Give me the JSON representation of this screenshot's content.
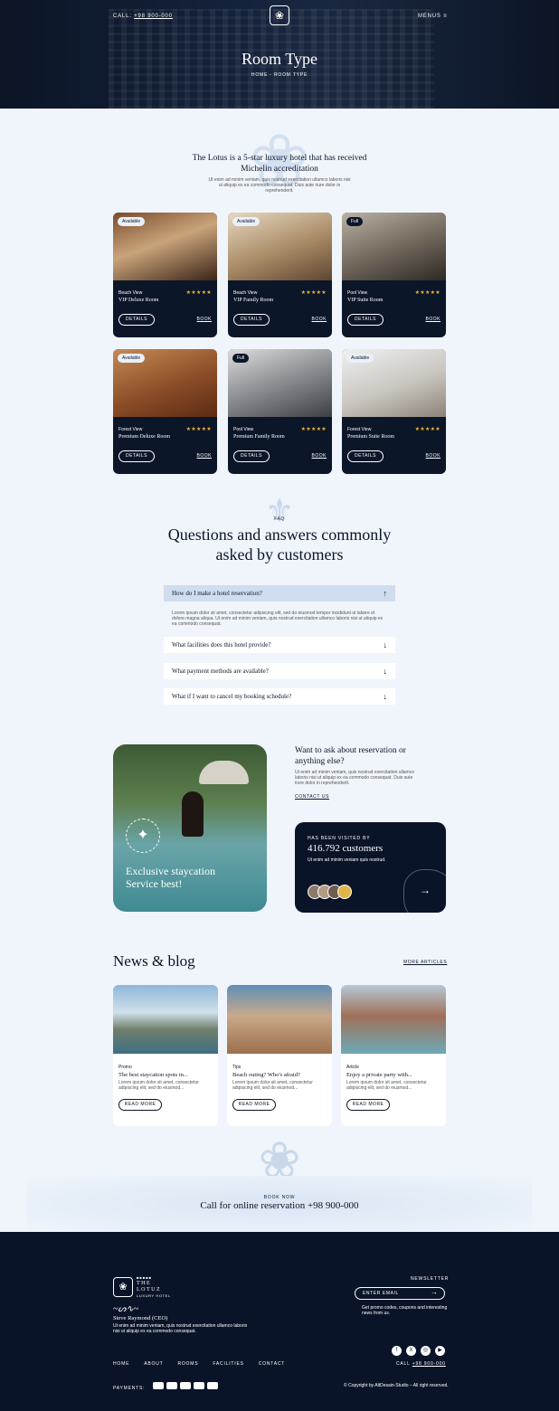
{
  "header": {
    "call": "CALL:",
    "phone": "+98 900-000",
    "menus": "MENUS",
    "title": "Room Type",
    "breadcrumb": "HOME - ROOM TYPE"
  },
  "intro": {
    "headline_1": "The Lotus is a 5-star luxury hotel that has received",
    "headline_2": "Michelin accreditation",
    "text_1": "Ut enim ad minim veniam, quis nostrud exercitation ullamco laboris nisi",
    "text_2": "ut aliquip ex ea commodo consequat. Duis aute irure dolor in",
    "text_3": "reprehenderit."
  },
  "rooms": [
    {
      "badge": "Available",
      "view": "Beach View",
      "name": "VIP Deluxe Room",
      "stars": "★★★★★",
      "details": "DETAILS",
      "book": "BOOK"
    },
    {
      "badge": "Available",
      "view": "Beach View",
      "name": "VIP Family Room",
      "stars": "★★★★★",
      "details": "DETAILS",
      "book": "BOOK"
    },
    {
      "badge": "Full",
      "view": "Pool View",
      "name": "VIP Suite Room",
      "stars": "★★★★★",
      "details": "DETAILS",
      "book": "BOOK"
    },
    {
      "badge": "Available",
      "view": "Forest View",
      "name": "Premium Deluxe Room",
      "stars": "★★★★★",
      "details": "DETAILS",
      "book": "BOOK"
    },
    {
      "badge": "Full",
      "view": "Pool View",
      "name": "Premium Family Room",
      "stars": "★★★★★",
      "details": "DETAILS",
      "book": "BOOK"
    },
    {
      "badge": "Available",
      "view": "Forest View",
      "name": "Premium Suite Room",
      "stars": "★★★★★",
      "details": "DETAILS",
      "book": "BOOK"
    }
  ],
  "faq": {
    "eyebrow": "FAQ",
    "title_1": "Questions and answers commonly",
    "title_2": "asked by customers",
    "items": [
      {
        "q": "How do I make a hotel reservation?",
        "open": true
      },
      {
        "q": "What facilities does this hotel provide?",
        "open": false
      },
      {
        "q": "What payment methods are available?",
        "open": false
      },
      {
        "q": "What if I want to cancel my booking schedule?",
        "open": false
      }
    ],
    "answer_1": "Lorem ipsum dolor sit amet, consectetur adipiscing elit, sed do eiusmod tempor incididunt ut labore et",
    "answer_2": "dolore magna aliqua. Ut enim ad minim veniam, quis nostrud exercitation ullamco laboris nisi ut aliquip ex",
    "answer_3": "ea commodo consequat."
  },
  "promo": {
    "image_caption_1": "Exclusive staycation",
    "image_caption_2": "Service best!",
    "ask_title_1": "Want to ask about reservation or",
    "ask_title_2": "anything else?",
    "ask_text_1": "Ut enim ad minim veniam, quis nostrud exercitation ullamco",
    "ask_text_2": "laboris nisi ut aliquip ex ea commodo consequat. Duis aute",
    "ask_text_3": "irure dolor in reprehenderit.",
    "contact": "CONTACT US",
    "visited_label": "HAS BEEN VISITED BY",
    "visited_count": "416.792 customers",
    "visited_text": "Ut enim ad minim veniam quis nostrud."
  },
  "blog": {
    "title": "News & blog",
    "more": "MORE ARTICLES",
    "posts": [
      {
        "cat": "Promo",
        "title": "The best staycation spots in...",
        "ex1": "Lorem ipsum dolor sit amet, consectetur",
        "ex2": "adipiscing elit, sed do eiusmod...",
        "btn": "READ MORE"
      },
      {
        "cat": "Tips",
        "title": "Beach outing? Who's afraid?",
        "ex1": "Lorem ipsum dolor sit amet, consectetur",
        "ex2": "adipiscing elit, sed do eiusmod...",
        "btn": "READ MORE"
      },
      {
        "cat": "Article",
        "title": "Enjoy a private party with...",
        "ex1": "Lorem ipsum dolor sit amet, consectetur",
        "ex2": "adipiscing elit, sed do eiusmod...",
        "btn": "READ MORE"
      }
    ]
  },
  "cta": {
    "eyebrow": "BOOK NOW",
    "text": "Call for online reservation +98 900-000"
  },
  "footer": {
    "logo_line1": "THE",
    "logo_line2": "LOTUZ",
    "logo_line3": "LUXURY HOTEL",
    "signature": "Steve Raymond (CEO)",
    "bio_1": "Ut enim ad minim veniam, quis nostrud exercitation ullamco laboris",
    "bio_2": "nisi ut aliquip ex ea commodo consequat.",
    "newsletter": "NEWSLETTER",
    "email_placeholder": "ENTER EMAIL",
    "newsletter_text_1": "Get promo codes, coupons and interesting",
    "newsletter_text_2": "news from us.",
    "nav": [
      "HOME",
      "ABOUT",
      "ROOMS",
      "FACILITIES",
      "CONTACT"
    ],
    "call": "CALL",
    "phone": "+98 900-000",
    "payments": "PAYMENTS:",
    "copyright": "© Copyright by AltDesain-Studio – All right reserved."
  },
  "colors": {
    "navy": "#0a1428",
    "bg": "#f0f5fb",
    "star": "#f2b632",
    "accent": "#b9cbe6"
  }
}
